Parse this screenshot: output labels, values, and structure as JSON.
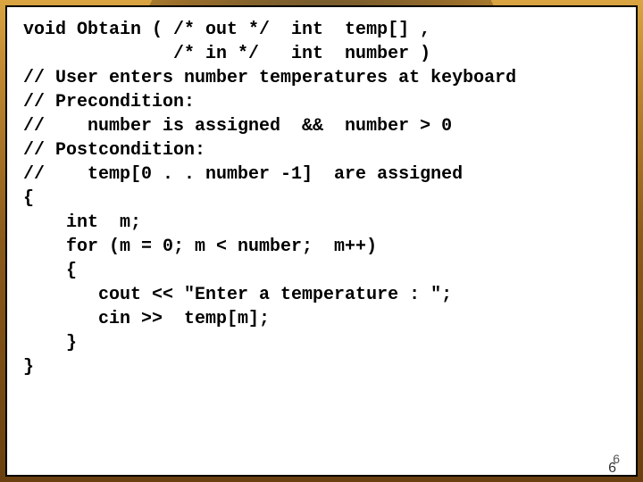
{
  "code": {
    "l1": "void Obtain ( /* out */  int  temp[] ,",
    "l2": "              /* in */   int  number )",
    "l3": "",
    "l4": "// User enters number temperatures at keyboard",
    "l5": "",
    "l6": "// Precondition:",
    "l7": "//    number is assigned  &&  number > 0",
    "l8": "// Postcondition:",
    "l9": "//    temp[0 . . number -1]  are assigned",
    "l10": "{",
    "l11": "    int  m;",
    "l12": "",
    "l13": "    for (m = 0; m < number;  m++)",
    "l14": "    {",
    "l15": "       cout << \"Enter a temperature : \";",
    "l16": "       cin >>  temp[m];",
    "l17": "    }",
    "l18": "}"
  },
  "page": {
    "outer": "6",
    "inner": "6"
  }
}
